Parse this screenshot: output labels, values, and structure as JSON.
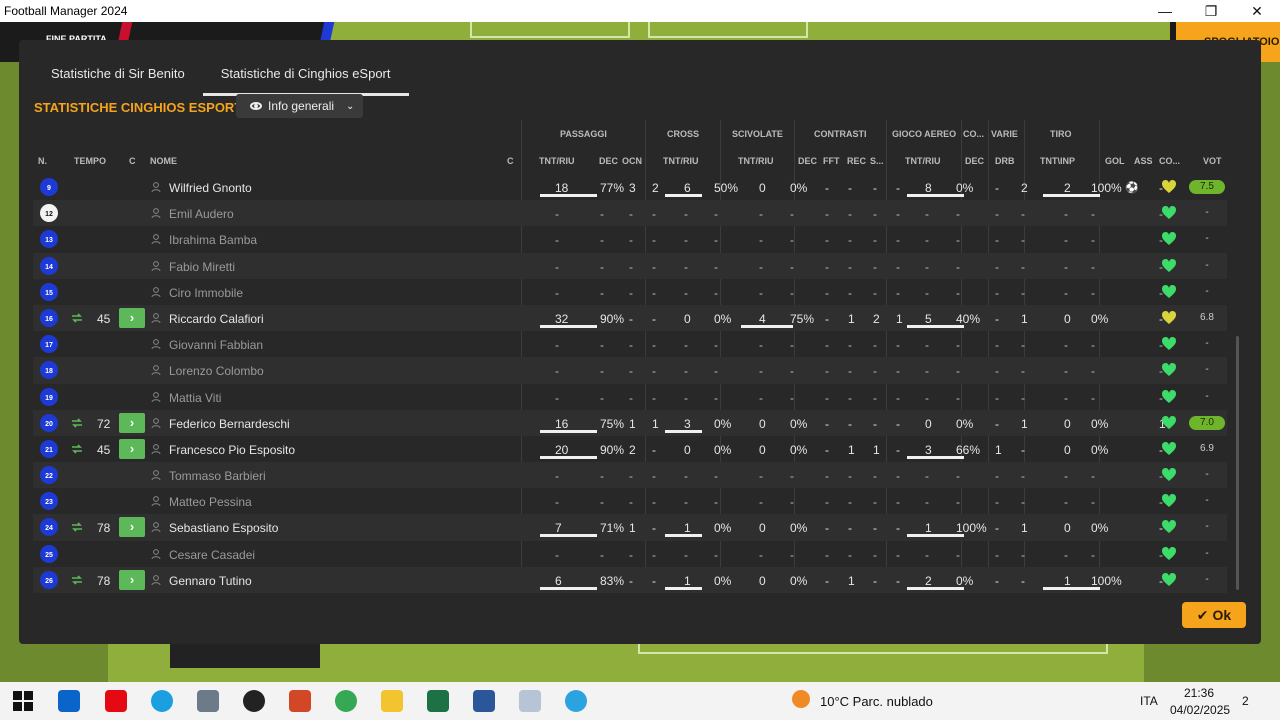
{
  "window": {
    "title": "Football Manager 2024",
    "min": "—",
    "max": "❐",
    "close": "✕"
  },
  "gamebar": {
    "status": "FINE PARTITA",
    "button": "SPOGLIATOIO"
  },
  "tabs": [
    {
      "label": "Statistiche di Sir Benito"
    },
    {
      "label": "Statistiche di Cinghios eSport"
    }
  ],
  "section_title": "STATISTICHE CINGHIOS ESPORT",
  "dropdown": {
    "label": "Info generali"
  },
  "groups": {
    "passaggi": "PASSAGGI",
    "cross": "CROSS",
    "scivolate": "SCIVOLATE",
    "contrasti": "CONTRASTI",
    "aereo": "GIOCO AEREO",
    "co": "CO...",
    "varie": "VARIE",
    "tiro": "TIRO"
  },
  "columns": {
    "n": "N.",
    "tempo": "TEMPO",
    "c": "C",
    "nome": "NOME",
    "c2": "C",
    "p_tnt": "TNT/RIU",
    "p_dec": "DEC",
    "p_ocn": "OCN",
    "cr_tnt": "TNT/RIU",
    "sc_tnt": "TNT/RIU",
    "ct_dec": "DEC",
    "ct_fft": "FFT",
    "ct_rec": "REC",
    "ct_s": "S...",
    "a_tnt": "TNT/RIU",
    "co_dec": "DEC",
    "drb": "DRB",
    "tiro": "TNT\\INP",
    "gol": "GOL",
    "ass": "ASS",
    "co2": "CO...",
    "vot": "VOT"
  },
  "players": [
    {
      "num": "9",
      "name": "Wilfried Gnonto",
      "played": true,
      "sub_in": "",
      "p_t": "18",
      "p_r": "77%",
      "p_dec": "3",
      "p_ocn": "2",
      "cr_t": "6",
      "cr_r": "50%",
      "sc_t": "0",
      "sc_r": "0%",
      "ct_dec": "-",
      "ct_fft": "-",
      "ct_rec": "-",
      "ct_s": "-",
      "a_t": "8",
      "a_r": "0%",
      "co_dec": "-",
      "drb": "2",
      "ti_t": "2",
      "ti_r": "100%",
      "gol": "⚽",
      "ass": "-",
      "vot": "7.5",
      "good": true,
      "heart": "yellow"
    },
    {
      "num": "12",
      "name": "Emil Audero",
      "played": false,
      "gk": true
    },
    {
      "num": "13",
      "name": "Ibrahima Bamba",
      "played": false
    },
    {
      "num": "14",
      "name": "Fabio Miretti",
      "played": false
    },
    {
      "num": "15",
      "name": "Ciro Immobile",
      "played": false
    },
    {
      "num": "16",
      "name": "Riccardo Calafiori",
      "played": true,
      "sub_in": "45",
      "p_t": "32",
      "p_r": "90%",
      "p_dec": "-",
      "p_ocn": "-",
      "cr_t": "0",
      "cr_r": "0%",
      "sc_t": "4",
      "sc_r": "75%",
      "ct_dec": "-",
      "ct_fft": "1",
      "ct_rec": "2",
      "ct_s": "1",
      "a_t": "5",
      "a_r": "40%",
      "co_dec": "-",
      "drb": "1",
      "ti_t": "0",
      "ti_r": "0%",
      "gol": "",
      "ass": "-",
      "vot": "6.8",
      "good": false,
      "heart": "yellow"
    },
    {
      "num": "17",
      "name": "Giovanni Fabbian",
      "played": false
    },
    {
      "num": "18",
      "name": "Lorenzo Colombo",
      "played": false
    },
    {
      "num": "19",
      "name": "Mattia Viti",
      "played": false
    },
    {
      "num": "20",
      "name": "Federico Bernardeschi",
      "played": true,
      "sub_in": "72",
      "p_t": "16",
      "p_r": "75%",
      "p_dec": "1",
      "p_ocn": "1",
      "cr_t": "3",
      "cr_r": "0%",
      "sc_t": "0",
      "sc_r": "0%",
      "ct_dec": "-",
      "ct_fft": "-",
      "ct_rec": "-",
      "ct_s": "-",
      "a_t": "0",
      "a_r": "0%",
      "co_dec": "-",
      "drb": "1",
      "ti_t": "0",
      "ti_r": "0%",
      "gol": "",
      "ass": "1",
      "vot": "7.0",
      "good": true,
      "heart": "green"
    },
    {
      "num": "21",
      "name": "Francesco Pio Esposito",
      "played": true,
      "sub_in": "45",
      "p_t": "20",
      "p_r": "90%",
      "p_dec": "2",
      "p_ocn": "-",
      "cr_t": "0",
      "cr_r": "0%",
      "sc_t": "0",
      "sc_r": "0%",
      "ct_dec": "-",
      "ct_fft": "1",
      "ct_rec": "1",
      "ct_s": "-",
      "a_t": "3",
      "a_r": "66%",
      "co_dec": "1",
      "drb": "-",
      "ti_t": "0",
      "ti_r": "0%",
      "gol": "",
      "ass": "-",
      "vot": "6.9",
      "good": false,
      "heart": "green"
    },
    {
      "num": "22",
      "name": "Tommaso Barbieri",
      "played": false
    },
    {
      "num": "23",
      "name": "Matteo Pessina",
      "played": false
    },
    {
      "num": "24",
      "name": "Sebastiano Esposito",
      "played": true,
      "sub_in": "78",
      "p_t": "7",
      "p_r": "71%",
      "p_dec": "1",
      "p_ocn": "-",
      "cr_t": "1",
      "cr_r": "0%",
      "sc_t": "0",
      "sc_r": "0%",
      "ct_dec": "-",
      "ct_fft": "-",
      "ct_rec": "-",
      "ct_s": "-",
      "a_t": "1",
      "a_r": "100%",
      "co_dec": "-",
      "drb": "1",
      "ti_t": "0",
      "ti_r": "0%",
      "gol": "",
      "ass": "-",
      "vot": "-",
      "good": false,
      "heart": "green"
    },
    {
      "num": "25",
      "name": "Cesare Casadei",
      "played": false
    },
    {
      "num": "26",
      "name": "Gennaro Tutino",
      "played": true,
      "sub_in": "78",
      "p_t": "6",
      "p_r": "83%",
      "p_dec": "-",
      "p_ocn": "-",
      "cr_t": "1",
      "cr_r": "0%",
      "sc_t": "0",
      "sc_r": "0%",
      "ct_dec": "-",
      "ct_fft": "1",
      "ct_rec": "-",
      "ct_s": "-",
      "a_t": "2",
      "a_r": "0%",
      "co_dec": "-",
      "drb": "-",
      "ti_t": "1",
      "ti_r": "100%",
      "gol": "",
      "ass": "-",
      "vot": "-",
      "good": false,
      "heart": "green"
    }
  ],
  "ok_button": "Ok",
  "taskbar": {
    "weather": "10°C  Parc. nublado",
    "lang": "ITA",
    "time": "21:36",
    "date": "04/02/2025",
    "notif": "2"
  },
  "colors": {
    "accent": "#f5a41c",
    "good_rating": "#6fb52c",
    "heart_green": "#3ddc6a",
    "heart_yellow": "#d8d43a",
    "shirt_blue": "#1e3ad6"
  }
}
